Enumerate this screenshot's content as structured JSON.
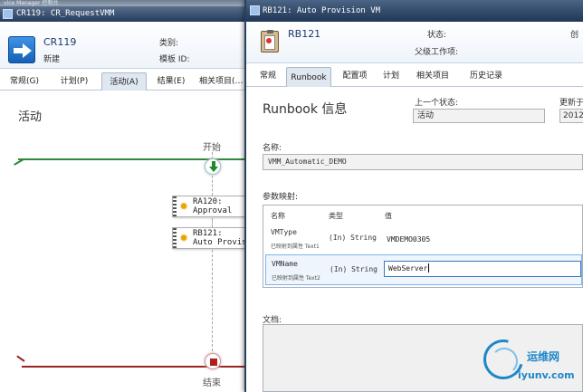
{
  "back_window": {
    "menu_strip_text": "vice Manager 控制台",
    "title": "CR119: CR_RequestVMM",
    "header": {
      "id": "CR119",
      "status": "新建",
      "category_label": "类别:",
      "template_label": "模板 ID:"
    },
    "tabs": [
      "常规(G)",
      "计划(P)",
      "活动(A)",
      "结果(E)",
      "相关项目(…"
    ],
    "selected_tab": "活动(A)",
    "heading": "活动",
    "flow": {
      "start_label": "开始",
      "end_label": "结束",
      "activities": [
        {
          "id": "RA120:",
          "name": "Approval"
        },
        {
          "id": "RB121:",
          "name": "Auto Provis-"
        }
      ]
    }
  },
  "front_window": {
    "title": "RB121: Auto Provision VM",
    "header": {
      "id": "RB121",
      "status_label": "状态:",
      "parent_label": "父级工作项:",
      "created_label": "创"
    },
    "tabs": [
      "常规",
      "Runbook",
      "配置项",
      "计划",
      "相关项目",
      "历史记录"
    ],
    "selected_tab": "Runbook",
    "heading": "Runbook 信息",
    "previous_state": {
      "label": "上一个状态:",
      "value": "活动"
    },
    "updated": {
      "label": "更新于",
      "value": "2012"
    },
    "name": {
      "label": "名称:",
      "value": "VMM_Automatic_DEMO"
    },
    "param_mapping": {
      "label": "参数映射:",
      "columns": [
        "名称",
        "类型",
        "值"
      ],
      "rows": [
        {
          "name": "VMType",
          "sub": "已映射到属性 Text1",
          "type": "(In) String",
          "value": "VMDEMO0305"
        },
        {
          "name": "VMName",
          "sub": "已映射到属性 Text2",
          "type": "(In) String",
          "value": "WebServer"
        }
      ],
      "selected_row": 1
    },
    "documentation_label": "文档:"
  },
  "watermark": {
    "name": "运维网",
    "url": "iyunv.com"
  },
  "colors": {
    "titlebar": "#243b5e",
    "flow_start_line": "#2e8a36",
    "flow_end_line": "#9b2323",
    "selection_border": "#3a78c0",
    "watermark": "#1e86c9"
  }
}
